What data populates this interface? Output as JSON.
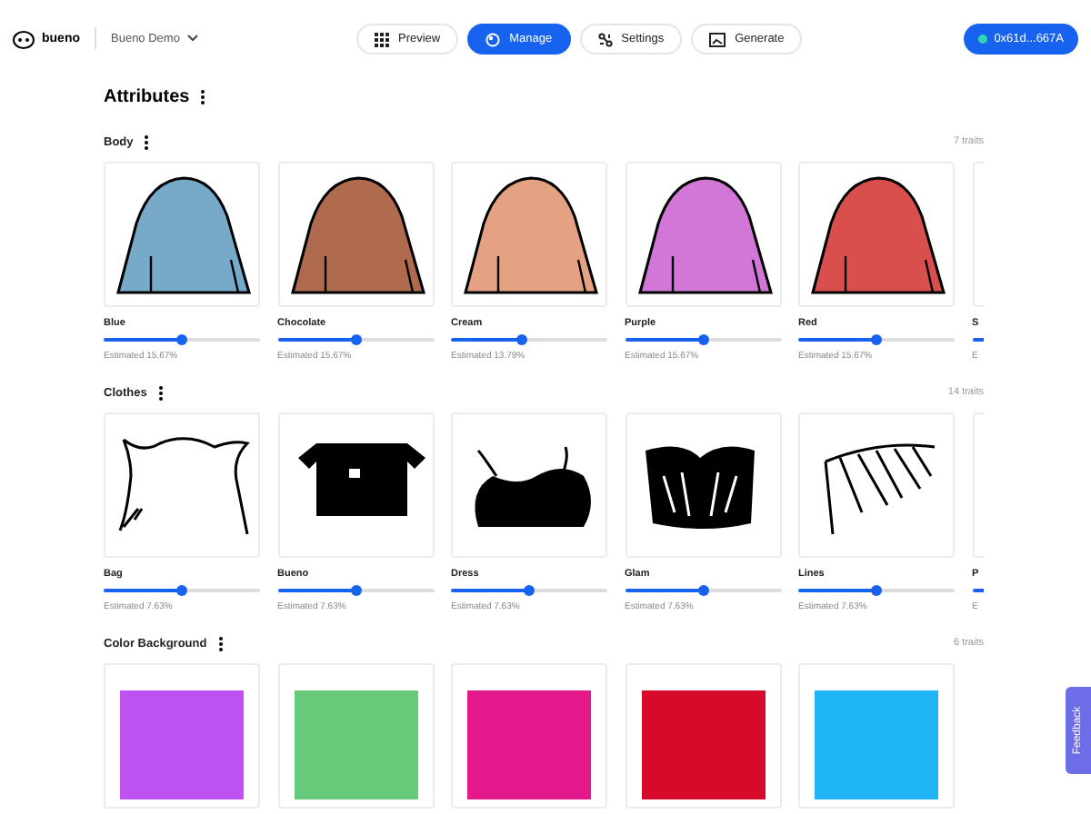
{
  "header": {
    "brand": "bueno",
    "project": "Bueno Demo",
    "nav": [
      {
        "label": "Preview",
        "selected": false,
        "kind": "grid"
      },
      {
        "label": "Manage",
        "selected": true,
        "kind": "palette"
      },
      {
        "label": "Settings",
        "selected": false,
        "kind": "settings"
      },
      {
        "label": "Generate",
        "selected": false,
        "kind": "image"
      }
    ],
    "wallet": "0x61d...667A"
  },
  "title": "Attributes",
  "sections": [
    {
      "name": "Body",
      "count": "7 traits",
      "kind": "shape",
      "items": [
        {
          "name": "Blue",
          "color": "#77a9c9",
          "level": 0.5,
          "estimate": "Estimated 15.67%"
        },
        {
          "name": "Chocolate",
          "color": "#b06b4f",
          "level": 0.5,
          "estimate": "Estimated 15.67%"
        },
        {
          "name": "Cream",
          "color": "#e4a283",
          "level": 0.45,
          "estimate": "Estimated 13.79%"
        },
        {
          "name": "Purple",
          "color": "#d276d8",
          "level": 0.5,
          "estimate": "Estimated 15.67%"
        },
        {
          "name": "Red",
          "color": "#d94f4e",
          "level": 0.5,
          "estimate": "Estimated 15.67%"
        },
        {
          "name": "S",
          "level": 0.5,
          "estimate": "E"
        }
      ]
    },
    {
      "name": "Clothes",
      "count": "14 traits",
      "kind": "clothing",
      "items": [
        {
          "name": "Bag",
          "level": 0.5,
          "estimate": "Estimated 7.63%"
        },
        {
          "name": "Bueno",
          "level": 0.5,
          "estimate": "Estimated 7.63%"
        },
        {
          "name": "Dress",
          "level": 0.5,
          "estimate": "Estimated 7.63%"
        },
        {
          "name": "Glam",
          "level": 0.5,
          "estimate": "Estimated 7.63%"
        },
        {
          "name": "Lines",
          "level": 0.5,
          "estimate": "Estimated 7.63%"
        },
        {
          "name": "P",
          "level": 0.5,
          "estimate": "E"
        }
      ]
    },
    {
      "name": "Color Background",
      "count": "6 traits",
      "kind": "swatch",
      "items": [
        {
          "color": "#be52f0"
        },
        {
          "color": "#68c97a"
        },
        {
          "color": "#e3188a"
        },
        {
          "color": "#d60a2b"
        },
        {
          "color": "#1eb4f5"
        }
      ]
    }
  ],
  "feedback": "Feedback"
}
